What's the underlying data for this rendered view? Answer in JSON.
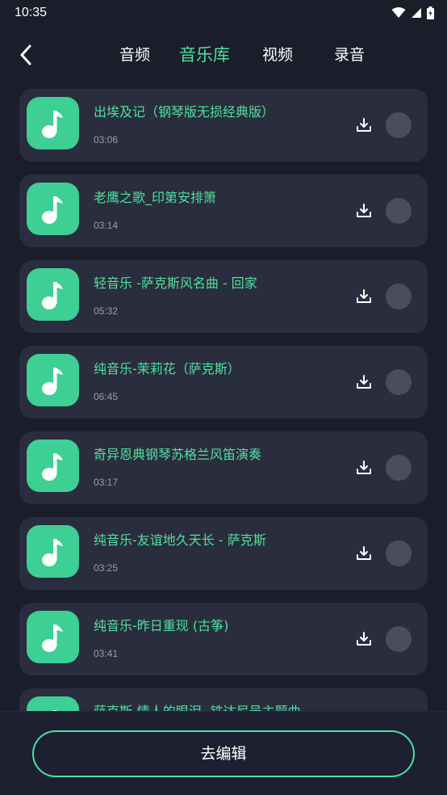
{
  "status_bar": {
    "time": "10:35"
  },
  "header": {
    "tabs": [
      {
        "label": "音频",
        "active": false
      },
      {
        "label": "音乐库",
        "active": true
      },
      {
        "label": "视频",
        "active": false
      },
      {
        "label": "录音",
        "active": false
      }
    ]
  },
  "tracks": [
    {
      "title": "出埃及记（钢琴版无损经典版）",
      "duration": "03:06"
    },
    {
      "title": "老鹰之歌_印第安排箫",
      "duration": "03:14"
    },
    {
      "title": "轻音乐 -萨克斯风名曲 - 回家",
      "duration": "05:32"
    },
    {
      "title": "纯音乐-茉莉花（萨克斯）",
      "duration": "06:45"
    },
    {
      "title": "奇异恩典钢琴苏格兰风笛演奏",
      "duration": "03:17"
    },
    {
      "title": "纯音乐-友谊地久天长 - 萨克斯",
      "duration": "03:25"
    },
    {
      "title": "纯音乐-昨日重现 (古筝)",
      "duration": "03:41"
    },
    {
      "title": "萨克斯-情人的眼泪 -铁达尼号主题曲",
      "duration": ""
    }
  ],
  "footer": {
    "edit_label": "去编辑"
  },
  "colors": {
    "accent": "#4fe0a0",
    "thumb": "#3ecf94",
    "background": "#1b1d2a",
    "card": "#2a2d3d"
  },
  "icons": {
    "back": "chevron-left-icon",
    "track": "music-note-icon",
    "download": "download-icon"
  }
}
